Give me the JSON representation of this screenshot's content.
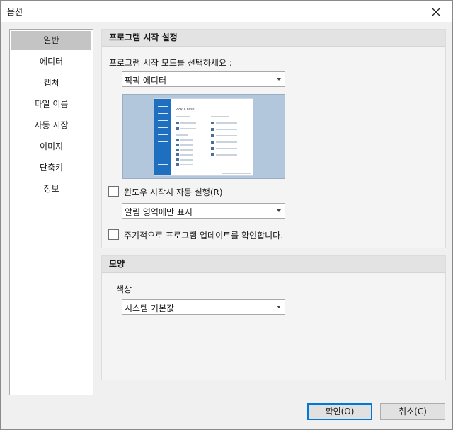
{
  "window": {
    "title": "옵션"
  },
  "sidebar": {
    "items": [
      {
        "label": "일반",
        "active": true
      },
      {
        "label": "에디터"
      },
      {
        "label": "캡처"
      },
      {
        "label": "파일 이름"
      },
      {
        "label": "자동 저장"
      },
      {
        "label": "이미지"
      },
      {
        "label": "단축키"
      },
      {
        "label": "정보"
      }
    ]
  },
  "startup": {
    "heading": "프로그램 시작 설정",
    "mode_label": "프로그램 시작 모드를 선택하세요 :",
    "mode_value": "픽픽 에디터",
    "preview_text": "Pick a task...",
    "autostart_label": "윈도우 시작시 자동 실행(R)",
    "autostart_checked": false,
    "tray_value": "알림 영역에만 표시",
    "update_label": "주기적으로 프로그램 업데이트를 확인합니다.",
    "update_checked": false
  },
  "appearance": {
    "heading": "모양",
    "color_label": "색상",
    "color_value": "시스템 기본값"
  },
  "buttons": {
    "ok_label": "확인(O)",
    "cancel_label": "취소(C)"
  },
  "colors": {
    "selection": "#c4c4c4",
    "preview_bg": "#b2c7dc",
    "preview_sidebar": "#1e6fbf",
    "default_button_border": "#0078d7"
  }
}
